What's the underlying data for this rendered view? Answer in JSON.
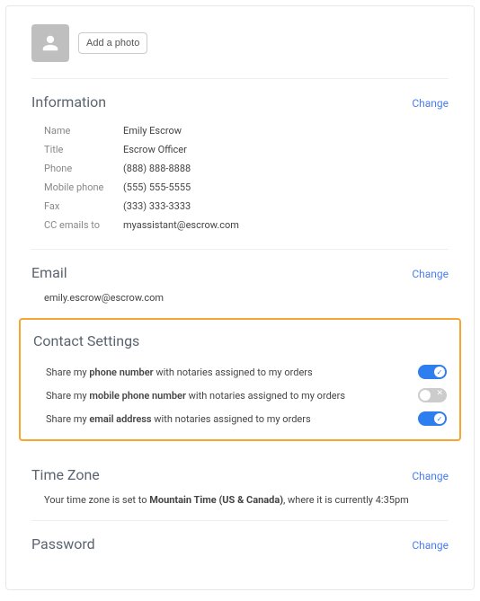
{
  "photo": {
    "button_label": "Add a photo"
  },
  "information": {
    "title": "Information",
    "change": "Change",
    "rows": [
      {
        "label": "Name",
        "value": "Emily Escrow"
      },
      {
        "label": "Title",
        "value": "Escrow Officer"
      },
      {
        "label": "Phone",
        "value": "(888) 888-8888"
      },
      {
        "label": "Mobile phone",
        "value": "(555) 555-5555"
      },
      {
        "label": "Fax",
        "value": "(333) 333-3333"
      },
      {
        "label": "CC emails to",
        "value": "myassistant@escrow.com"
      }
    ]
  },
  "email": {
    "title": "Email",
    "change": "Change",
    "value": "emily.escrow@escrow.com"
  },
  "contact_settings": {
    "title": "Contact Settings",
    "rows": [
      {
        "pre": "Share my ",
        "bold": "phone number",
        "post": " with notaries assigned to my orders",
        "on": true
      },
      {
        "pre": "Share my ",
        "bold": "mobile phone number",
        "post": " with notaries assigned to my orders",
        "on": false
      },
      {
        "pre": "Share my ",
        "bold": "email address",
        "post": " with notaries assigned to my orders",
        "on": true
      }
    ]
  },
  "timezone": {
    "title": "Time Zone",
    "change": "Change",
    "pre": "Your time zone is set to ",
    "bold": "Mountain Time (US & Canada)",
    "post": ", where it is currently 4:35pm"
  },
  "password": {
    "title": "Password",
    "change": "Change"
  }
}
